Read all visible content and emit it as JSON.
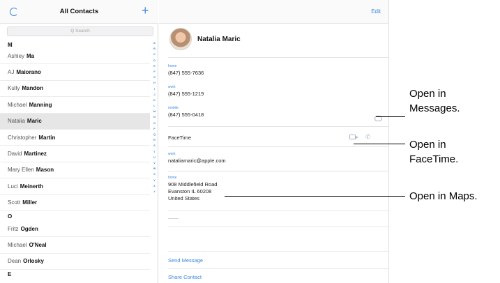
{
  "left_pane": {
    "title": "All Contacts",
    "add_label": "+",
    "search_placeholder": "Q Search",
    "rows": [
      {
        "type": "section",
        "letter": "M"
      },
      {
        "type": "contact",
        "first": "Ashley",
        "last": "Ma"
      },
      {
        "type": "contact",
        "first": "AJ",
        "last": "Maiorano"
      },
      {
        "type": "contact",
        "first": "Kully",
        "last": "Mandon"
      },
      {
        "type": "contact",
        "first": "Michael",
        "last": "Manning"
      },
      {
        "type": "contact",
        "first": "Natalia",
        "last": "Maric",
        "selected": true
      },
      {
        "type": "contact",
        "first": "Christopher",
        "last": "Martin"
      },
      {
        "type": "contact",
        "first": "David",
        "last": "Martinez"
      },
      {
        "type": "contact",
        "first": "Mary Ellen",
        "last": "Mason"
      },
      {
        "type": "contact",
        "first": "Luci",
        "last": "Meinerth"
      },
      {
        "type": "contact",
        "first": "Scott",
        "last": "Miller"
      },
      {
        "type": "section",
        "letter": "O"
      },
      {
        "type": "contact",
        "first": "Fritz",
        "last": "Ogden"
      },
      {
        "type": "contact",
        "first": "Michael",
        "last": "O'Neal"
      },
      {
        "type": "contact",
        "first": "Dean",
        "last": "Orlosky"
      },
      {
        "type": "section",
        "letter": "E"
      }
    ],
    "index_letters": [
      "A",
      "B",
      "C",
      "D",
      "E",
      "F",
      "G",
      "H",
      "I",
      "J",
      "K",
      "L",
      "M",
      "N",
      "O",
      "P",
      "Q",
      "R",
      "S",
      "T",
      "U",
      "V",
      "W",
      "X",
      "Y",
      "Z",
      "#"
    ]
  },
  "detail": {
    "edit_label": "Edit",
    "name": "Natalia Maric",
    "fields": [
      {
        "label": "home",
        "value": "(847) 555-7636"
      },
      {
        "label": "work",
        "value": "(847) 555-1219"
      },
      {
        "label": "mobile",
        "value": "(847) 555-0418"
      }
    ],
    "facetime_label": "FaceTime",
    "email": {
      "label": "work",
      "value": "nataliamaric@apple.com"
    },
    "address": {
      "label": "home",
      "lines": [
        "908 Middlefield Road",
        "Evanston IL 60208",
        "United States"
      ]
    },
    "actions": [
      "Send Message",
      "Share Contact"
    ]
  },
  "callouts": [
    {
      "lines": [
        "Open in",
        "Messages."
      ]
    },
    {
      "lines": [
        "Open in",
        "FaceTime."
      ]
    },
    {
      "lines": [
        "Open in Maps."
      ]
    }
  ]
}
